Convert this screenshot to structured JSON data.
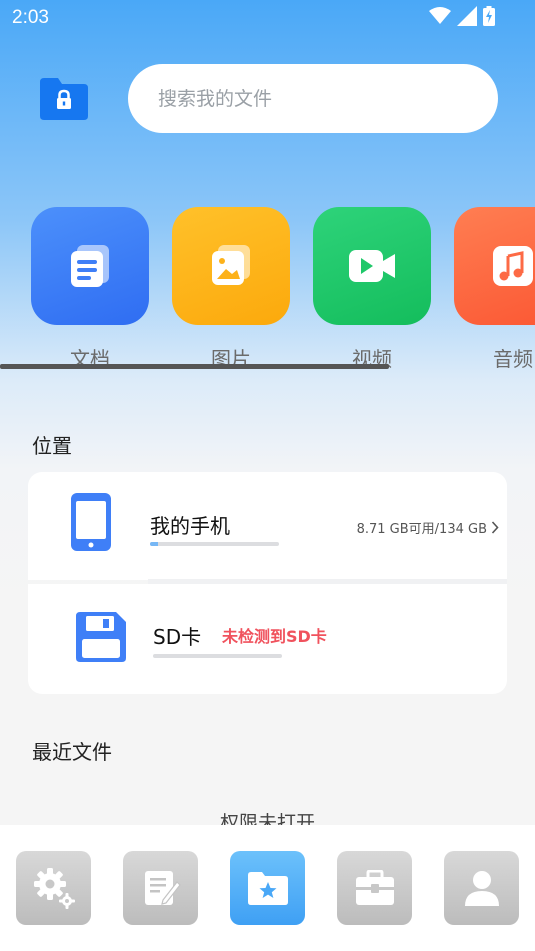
{
  "status_bar": {
    "time": "2:03",
    "icons": [
      "wifi-icon",
      "signal-icon",
      "battery-charging-icon"
    ]
  },
  "header": {
    "icon": "lock-folder-icon",
    "search_placeholder": "搜索我的文件"
  },
  "categories": [
    {
      "label": "文档",
      "icon": "document-icon",
      "color": "#3f7ff7"
    },
    {
      "label": "图片",
      "icon": "image-icon",
      "color": "#fdb21a"
    },
    {
      "label": "视频",
      "icon": "video-icon",
      "color": "#1fc869"
    },
    {
      "label": "音频",
      "icon": "music-icon",
      "color": "#fd6a45"
    }
  ],
  "location": {
    "title": "位置",
    "phone": {
      "name": "我的手机",
      "info": "8.71 GB可用/134 GB",
      "used_fraction": 0.065,
      "icon": "phone-icon"
    },
    "sd": {
      "name": "SD卡",
      "status": "未检测到SD卡",
      "used_fraction": 0,
      "icon": "sd-card-icon"
    }
  },
  "recent": {
    "title": "最近文件",
    "permission_text": "权限未打开"
  },
  "bottom_nav": [
    {
      "icon": "settings-icon",
      "active": false
    },
    {
      "icon": "edit-note-icon",
      "active": false
    },
    {
      "icon": "favorite-folder-icon",
      "active": true
    },
    {
      "icon": "toolbox-icon",
      "active": false
    },
    {
      "icon": "user-icon",
      "active": false
    }
  ],
  "colors": {
    "accent": "#3f8ff5",
    "warning": "#f0525d"
  }
}
